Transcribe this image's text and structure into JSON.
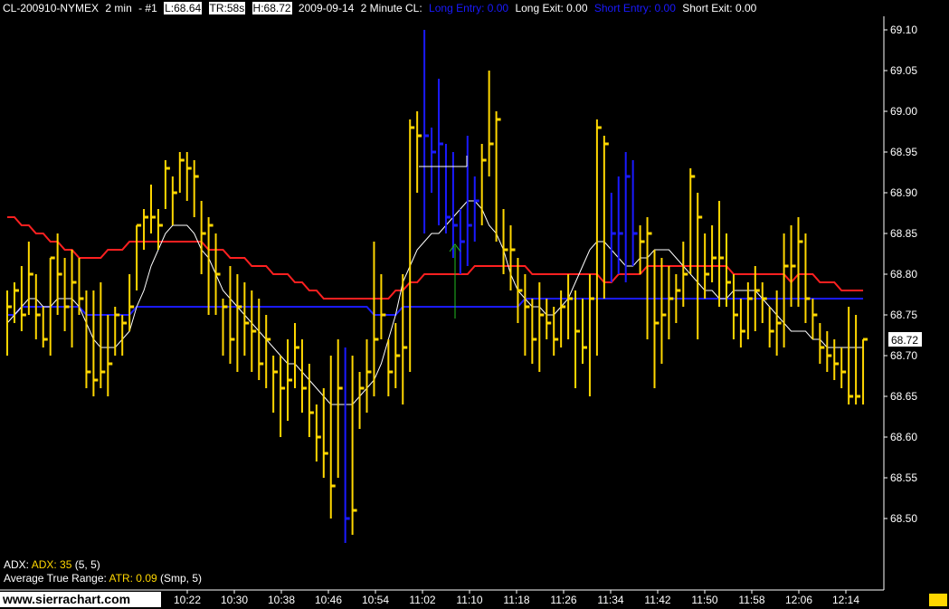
{
  "header": {
    "symbol": "CL-200910-NYMEX",
    "interval": "2 min",
    "chart_num": "- #1",
    "low": "L:68.64",
    "time_remaining": "TR:58s",
    "high": "H:68.72",
    "title_date": "2009-09-14",
    "title_desc": "2 Minute CL:",
    "long_entry": "Long Entry: 0.00",
    "long_exit": "Long Exit: 0.00",
    "short_entry": "Short Entry: 0.00",
    "short_exit": "Short Exit: 0.00"
  },
  "indicators": {
    "adx_label": "ADX:",
    "adx_value": "ADX: 35",
    "adx_params": "(5, 5)",
    "atr_label": "Average True Range:",
    "atr_value": "ATR: 0.09",
    "atr_params": "(Smp, 5)"
  },
  "branding": "www.sierrachart.com",
  "colors": {
    "background": "#000000",
    "bar_up": "#ffd700",
    "bar_highlight": "#1a1aff",
    "ma_red": "#ff2020",
    "ma_blue": "#1a1aff",
    "ma_white": "#ffffff",
    "long_entry": "#1a1aff",
    "short_entry": "#1a1aff"
  },
  "chart_data": {
    "type": "ohlc",
    "price_axis": {
      "ylim": [
        68.42,
        69.12
      ],
      "ticks": [
        "69.10",
        "69.05",
        "69.00",
        "68.95",
        "68.90",
        "68.85",
        "68.80",
        "68.75",
        "68.70",
        "68.65",
        "68.60",
        "68.55",
        "68.50"
      ],
      "last_price_label": "68.72"
    },
    "time_axis": {
      "ticks": [
        "10:22",
        "10:30",
        "10:38",
        "10:46",
        "10:54",
        "11:02",
        "11:10",
        "11:18",
        "11:26",
        "11:34",
        "11:42",
        "11:50",
        "11:58",
        "12:06",
        "12:14"
      ]
    },
    "bar_count": 120,
    "bars": [
      [
        68.78,
        68.7,
        68.76
      ],
      [
        68.79,
        68.74,
        68.78
      ],
      [
        68.81,
        68.73,
        68.75
      ],
      [
        68.84,
        68.75,
        68.8
      ],
      [
        68.8,
        68.72,
        68.75
      ],
      [
        68.76,
        68.71,
        68.72
      ],
      [
        68.82,
        68.7,
        68.82
      ],
      [
        68.85,
        68.75,
        68.8
      ],
      [
        68.82,
        68.73,
        68.76
      ],
      [
        68.83,
        68.71,
        68.79
      ],
      [
        68.82,
        68.75,
        68.77
      ],
      [
        68.78,
        68.66,
        68.68
      ],
      [
        68.78,
        68.65,
        68.67
      ],
      [
        68.79,
        68.66,
        68.68
      ],
      [
        68.75,
        68.65,
        68.69
      ],
      [
        68.76,
        68.7,
        68.75
      ],
      [
        68.75,
        68.7,
        68.74
      ],
      [
        68.8,
        68.73,
        68.76
      ],
      [
        68.86,
        68.78,
        68.86
      ],
      [
        68.88,
        68.83,
        68.87
      ],
      [
        68.91,
        68.85,
        68.87
      ],
      [
        68.88,
        68.83,
        68.86
      ],
      [
        68.94,
        68.88,
        68.93
      ],
      [
        68.92,
        68.86,
        68.9
      ],
      [
        68.95,
        68.9,
        68.94
      ],
      [
        68.95,
        68.89,
        68.93
      ],
      [
        68.94,
        68.87,
        68.92
      ],
      [
        68.89,
        68.8,
        68.85
      ],
      [
        68.87,
        68.75,
        68.86
      ],
      [
        68.85,
        68.75,
        68.8
      ],
      [
        68.77,
        68.7,
        68.76
      ],
      [
        68.81,
        68.69,
        68.72
      ],
      [
        68.8,
        68.68,
        68.76
      ],
      [
        68.79,
        68.7,
        68.74
      ],
      [
        68.78,
        68.68,
        68.73
      ],
      [
        68.77,
        68.67,
        68.69
      ],
      [
        68.75,
        68.66,
        68.72
      ],
      [
        68.7,
        68.63,
        68.68
      ],
      [
        68.7,
        68.6,
        68.66
      ],
      [
        68.72,
        68.62,
        68.67
      ],
      [
        68.74,
        68.66,
        68.71
      ],
      [
        68.72,
        68.63,
        68.66
      ],
      [
        68.69,
        68.6,
        68.63
      ],
      [
        68.64,
        68.57,
        68.6
      ],
      [
        68.66,
        68.55,
        68.58
      ],
      [
        68.7,
        68.5,
        68.54
      ],
      [
        68.72,
        68.55,
        68.66
      ],
      [
        68.71,
        68.47,
        68.5
      ],
      [
        68.7,
        68.48,
        68.51
      ],
      [
        68.68,
        68.61,
        68.66
      ],
      [
        68.72,
        68.63,
        68.68
      ],
      [
        68.84,
        68.65,
        68.72
      ],
      [
        68.8,
        68.72,
        68.75
      ],
      [
        68.72,
        68.65,
        68.68
      ],
      [
        68.74,
        68.66,
        68.7
      ],
      [
        68.8,
        68.64,
        68.71
      ],
      [
        68.99,
        68.68,
        68.98
      ],
      [
        69.0,
        68.9,
        68.97
      ],
      [
        69.1,
        68.85,
        68.97
      ],
      [
        68.98,
        68.9,
        68.95
      ],
      [
        69.04,
        68.86,
        68.96
      ],
      [
        68.96,
        68.85,
        68.87
      ],
      [
        68.95,
        68.82,
        68.86
      ],
      [
        68.88,
        68.8,
        68.84
      ],
      [
        68.97,
        68.81,
        68.86
      ],
      [
        68.92,
        68.84,
        68.89
      ],
      [
        68.96,
        68.86,
        68.94
      ],
      [
        69.05,
        68.92,
        68.96
      ],
      [
        69.0,
        68.84,
        68.99
      ],
      [
        68.88,
        68.8,
        68.83
      ],
      [
        68.86,
        68.78,
        68.83
      ],
      [
        68.82,
        68.74,
        68.78
      ],
      [
        68.8,
        68.7,
        68.76
      ],
      [
        68.77,
        68.69,
        68.72
      ],
      [
        68.79,
        68.68,
        68.75
      ],
      [
        68.77,
        68.72,
        68.74
      ],
      [
        68.76,
        68.7,
        68.72
      ],
      [
        68.78,
        68.71,
        68.76
      ],
      [
        68.8,
        68.72,
        68.77
      ],
      [
        68.78,
        68.66,
        68.73
      ],
      [
        68.77,
        68.69,
        68.71
      ],
      [
        68.8,
        68.65,
        68.77
      ],
      [
        68.99,
        68.7,
        68.98
      ],
      [
        68.97,
        68.77,
        68.96
      ],
      [
        68.9,
        68.79,
        68.85
      ],
      [
        68.92,
        68.8,
        68.85
      ],
      [
        68.95,
        68.79,
        68.92
      ],
      [
        68.94,
        68.81,
        68.85
      ],
      [
        68.86,
        68.8,
        68.84
      ],
      [
        68.87,
        68.72,
        68.85
      ],
      [
        68.83,
        68.66,
        68.74
      ],
      [
        68.82,
        68.69,
        68.75
      ],
      [
        68.81,
        68.72,
        68.77
      ],
      [
        68.8,
        68.74,
        68.78
      ],
      [
        68.84,
        68.76,
        68.8
      ],
      [
        68.93,
        68.8,
        68.92
      ],
      [
        68.9,
        68.72,
        68.87
      ],
      [
        68.85,
        68.77,
        68.8
      ],
      [
        68.86,
        68.79,
        68.82
      ],
      [
        68.89,
        68.76,
        68.82
      ],
      [
        68.85,
        68.76,
        68.79
      ],
      [
        68.8,
        68.72,
        68.75
      ],
      [
        68.77,
        68.71,
        68.73
      ],
      [
        68.79,
        68.72,
        68.77
      ],
      [
        68.81,
        68.73,
        68.78
      ],
      [
        68.79,
        68.74,
        68.77
      ],
      [
        68.76,
        68.71,
        68.73
      ],
      [
        68.78,
        68.7,
        68.74
      ],
      [
        68.85,
        68.71,
        68.81
      ],
      [
        68.86,
        68.76,
        68.81
      ],
      [
        68.87,
        68.76,
        68.84
      ],
      [
        68.85,
        68.74,
        68.77
      ],
      [
        68.77,
        68.72,
        68.75
      ],
      [
        68.74,
        68.69,
        68.71
      ],
      [
        68.73,
        68.68,
        68.7
      ],
      [
        68.72,
        68.67,
        68.69
      ],
      [
        68.71,
        68.66,
        68.68
      ],
      [
        68.76,
        68.64,
        68.65
      ],
      [
        68.75,
        68.64,
        68.65
      ],
      [
        68.72,
        68.64,
        68.72
      ]
    ],
    "highlight_bars": [
      44,
      45,
      46,
      47,
      48,
      49,
      50,
      51,
      52,
      53,
      54,
      55,
      56,
      57,
      58,
      59,
      60,
      61,
      62,
      63,
      64,
      65,
      66,
      67,
      68,
      69,
      70,
      71,
      72,
      73,
      74,
      75,
      76,
      77,
      78,
      79,
      80,
      81,
      82,
      83,
      84,
      85,
      86,
      87,
      88,
      89,
      90,
      91,
      92,
      93,
      94,
      95,
      96,
      97,
      98,
      99,
      100,
      101,
      102,
      103,
      104,
      105,
      106,
      107,
      108,
      109,
      110,
      111,
      112,
      113,
      114,
      115,
      116,
      117,
      118,
      119
    ],
    "blue_bars": [
      47,
      58,
      59,
      60,
      61,
      62,
      63,
      64,
      65,
      84,
      85,
      86,
      87
    ],
    "series_ma_red": [
      68.87,
      68.87,
      68.86,
      68.86,
      68.85,
      68.85,
      68.84,
      68.84,
      68.83,
      68.83,
      68.82,
      68.82,
      68.82,
      68.82,
      68.83,
      68.83,
      68.83,
      68.84,
      68.84,
      68.84,
      68.84,
      68.84,
      68.84,
      68.84,
      68.84,
      68.84,
      68.84,
      68.84,
      68.83,
      68.83,
      68.83,
      68.82,
      68.82,
      68.82,
      68.81,
      68.81,
      68.81,
      68.8,
      68.8,
      68.8,
      68.79,
      68.79,
      68.78,
      68.78,
      68.77,
      68.77,
      68.77,
      68.77,
      68.77,
      68.77,
      68.77,
      68.77,
      68.77,
      68.77,
      68.78,
      68.78,
      68.79,
      68.79,
      68.8,
      68.8,
      68.8,
      68.8,
      68.8,
      68.8,
      68.8,
      68.81,
      68.81,
      68.81,
      68.81,
      68.81,
      68.81,
      68.81,
      68.81,
      68.8,
      68.8,
      68.8,
      68.8,
      68.8,
      68.8,
      68.8,
      68.8,
      68.8,
      68.8,
      68.79,
      68.79,
      68.8,
      68.8,
      68.8,
      68.8,
      68.81,
      68.81,
      68.81,
      68.81,
      68.81,
      68.81,
      68.81,
      68.81,
      68.81,
      68.81,
      68.81,
      68.81,
      68.8,
      68.8,
      68.8,
      68.8,
      68.8,
      68.8,
      68.8,
      68.8,
      68.79,
      68.8,
      68.8,
      68.8,
      68.79,
      68.79,
      68.79,
      68.78,
      68.78,
      68.78,
      68.78
    ],
    "series_ma_blue_fast": [
      68.75,
      68.75,
      68.75,
      68.76,
      68.76,
      68.76,
      68.76,
      68.76,
      68.76,
      68.76,
      68.76,
      68.76,
      68.76,
      68.76,
      68.76,
      68.76,
      68.76,
      68.76,
      68.77,
      68.78,
      68.79,
      68.81,
      68.83,
      68.84,
      68.84,
      68.84,
      68.84,
      68.84,
      68.84,
      68.83,
      68.82,
      68.81,
      68.8,
      68.79,
      68.78,
      68.77,
      68.76,
      68.76,
      68.75,
      68.74,
      68.73,
      68.72,
      68.71,
      68.7,
      68.69,
      68.68,
      68.67,
      68.66,
      68.65,
      68.64,
      68.65,
      68.66,
      68.67,
      68.68,
      68.69,
      68.7,
      68.73,
      68.76,
      68.79,
      68.81,
      68.83,
      68.84,
      68.85,
      68.85,
      68.86,
      68.86,
      68.87,
      68.88,
      68.89,
      68.89,
      68.88,
      68.87,
      68.86,
      68.84,
      68.82,
      68.8,
      68.78,
      68.77,
      68.76,
      68.75,
      68.75,
      68.76,
      68.78,
      68.8,
      68.82,
      68.84,
      68.86,
      68.86,
      68.84,
      68.82,
      68.81,
      68.8,
      68.8,
      68.81,
      68.82,
      68.83,
      68.84,
      68.83,
      68.82,
      68.81,
      68.8,
      68.79,
      68.78,
      68.77,
      68.77,
      68.78,
      68.78,
      68.79,
      68.79,
      68.79,
      68.78,
      68.77,
      68.76,
      68.75,
      68.74,
      68.73,
      68.72,
      68.71,
      68.71,
      68.71
    ],
    "series_ma_blue_slow": [
      68.75,
      68.75,
      68.76,
      68.76,
      68.76,
      68.76,
      68.76,
      68.76,
      68.76,
      68.76,
      68.76,
      68.75,
      68.75,
      68.75,
      68.75,
      68.75,
      68.75,
      68.75,
      68.76,
      68.76,
      68.76,
      68.76,
      68.76,
      68.76,
      68.76,
      68.76,
      68.76,
      68.76,
      68.76,
      68.76,
      68.76,
      68.76,
      68.76,
      68.76,
      68.76,
      68.76,
      68.76,
      68.76,
      68.76,
      68.76,
      68.76,
      68.76,
      68.76,
      68.76,
      68.76,
      68.76,
      68.76,
      68.76,
      68.76,
      68.76,
      68.76,
      68.75,
      68.75,
      68.75,
      68.75,
      68.76,
      68.76,
      68.76,
      68.76,
      68.76,
      68.76,
      68.76,
      68.76,
      68.76,
      68.76,
      68.76,
      68.76,
      68.76,
      68.76,
      68.76,
      68.76,
      68.76,
      68.77,
      68.77,
      68.77,
      68.77,
      68.77,
      68.77,
      68.77,
      68.77,
      68.77,
      68.77,
      68.77,
      68.77,
      68.77,
      68.77,
      68.77,
      68.77,
      68.77,
      68.77,
      68.77,
      68.77,
      68.77,
      68.77,
      68.77,
      68.77,
      68.77,
      68.77,
      68.77,
      68.77,
      68.77,
      68.77,
      68.77,
      68.77,
      68.77,
      68.77,
      68.77,
      68.77,
      68.77,
      68.77,
      68.77,
      68.77,
      68.77,
      68.77,
      68.77,
      68.77,
      68.77,
      68.77,
      68.77,
      68.77
    ],
    "series_ma_white": [
      68.74,
      68.75,
      68.76,
      68.77,
      68.77,
      68.76,
      68.76,
      68.77,
      68.77,
      68.77,
      68.76,
      68.74,
      68.72,
      68.71,
      68.71,
      68.71,
      68.72,
      68.73,
      68.76,
      68.78,
      68.81,
      68.83,
      68.85,
      68.86,
      68.86,
      68.86,
      68.85,
      68.83,
      68.82,
      68.8,
      68.78,
      68.77,
      68.76,
      68.75,
      68.74,
      68.73,
      68.72,
      68.71,
      68.7,
      68.69,
      68.69,
      68.68,
      68.67,
      68.66,
      68.65,
      68.64,
      68.64,
      68.64,
      68.64,
      68.65,
      68.66,
      68.67,
      68.69,
      68.72,
      68.75,
      68.79,
      68.81,
      68.83,
      68.84,
      68.85,
      68.85,
      68.86,
      68.87,
      68.88,
      68.89,
      68.89,
      68.88,
      68.86,
      68.85,
      68.83,
      68.8,
      68.78,
      68.77,
      68.76,
      68.76,
      68.75,
      68.75,
      68.76,
      68.77,
      68.79,
      68.81,
      68.83,
      68.84,
      68.84,
      68.83,
      68.82,
      68.81,
      68.81,
      68.82,
      68.82,
      68.83,
      68.83,
      68.83,
      68.82,
      68.81,
      68.8,
      68.79,
      68.78,
      68.78,
      68.77,
      68.77,
      68.78,
      68.78,
      68.78,
      68.78,
      68.77,
      68.76,
      68.75,
      68.74,
      68.73,
      68.73,
      68.73,
      68.72,
      68.72,
      68.71,
      68.71,
      68.71,
      68.71,
      68.71,
      68.71
    ]
  }
}
